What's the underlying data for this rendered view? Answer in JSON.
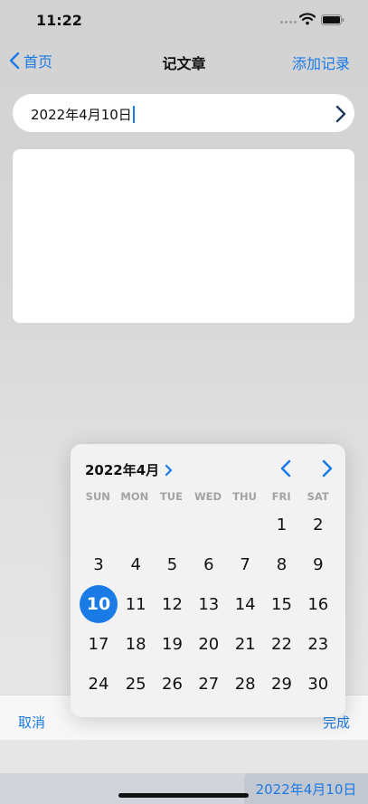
{
  "status_bar": {
    "time": "11:22"
  },
  "nav": {
    "back_label": "首页",
    "title": "记文章",
    "add_record": "添加记录"
  },
  "date_field": {
    "value": "2022年4月10日"
  },
  "calendar": {
    "month_label": "2022年4月",
    "weekdays": [
      "SUN",
      "MON",
      "TUE",
      "WED",
      "THU",
      "FRI",
      "SAT"
    ],
    "days": [
      "",
      "",
      "",
      "",
      "",
      "1",
      "2",
      "3",
      "4",
      "5",
      "6",
      "7",
      "8",
      "9",
      "10",
      "11",
      "12",
      "13",
      "14",
      "15",
      "16",
      "17",
      "18",
      "19",
      "20",
      "21",
      "22",
      "23",
      "24",
      "25",
      "26",
      "27",
      "28",
      "29",
      "30"
    ],
    "selected_day": "10"
  },
  "toolbar": {
    "cancel": "取消",
    "done": "完成"
  },
  "suggestion": {
    "text": "2022年4月10日"
  },
  "colors": {
    "accent": "#1a7ae6"
  }
}
